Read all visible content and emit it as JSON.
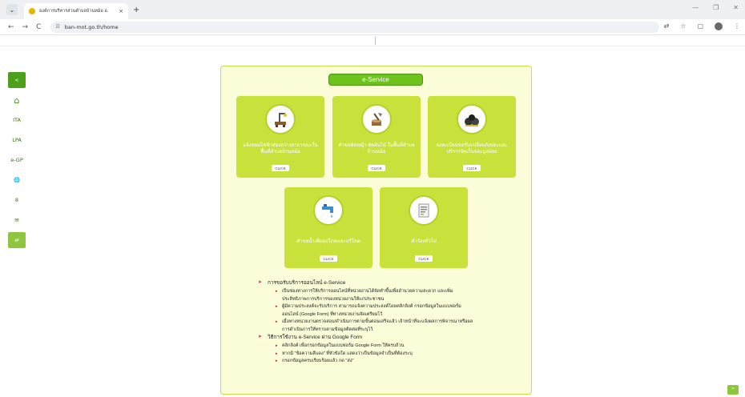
{
  "browser": {
    "tab_title": "องค์การบริหารส่วนตำบลบ้านหม้อ อ.",
    "url": "ban-mot.go.th/home",
    "new_tab": "+",
    "tab_close": "×"
  },
  "sidebar": {
    "items": [
      {
        "label": "<",
        "icon": "chevron-left-icon"
      },
      {
        "label": "⌂",
        "icon": "home-icon"
      },
      {
        "label": "ITA"
      },
      {
        "label": "LPA"
      },
      {
        "label": "e-GP"
      },
      {
        "label": "🌐",
        "icon": "globe-icon"
      },
      {
        "label": "8",
        "icon": "user-icon"
      },
      {
        "label": "✉",
        "icon": "mail-icon"
      },
      {
        "label": "⇄",
        "icon": "translate-icon"
      }
    ]
  },
  "panel": {
    "title": "e-Service",
    "services": [
      {
        "label": "แจ้งซ่อมไฟฟ้าส่องสว่างสาธารณะในพื้นที่ตำบลบ้านหม้อ",
        "click": "CLICK",
        "icon": "streetlight-icon"
      },
      {
        "label": "คำขอตัดหญ้า ตัดต้นไม้ ในพื้นที่ตำบลบ้านหม้อ",
        "click": "CLICK",
        "icon": "axe-stump-icon"
      },
      {
        "label": "ลงทะเบียนขอรับ/เปลี่ยนถังขยะและบริการจัดเก็บขยะมูลฝอย",
        "click": "CLICK",
        "icon": "garbage-bags-icon"
      },
      {
        "label": "คำขอน้ำเพื่ออุปโภคและบริโภค",
        "click": "CLICK",
        "icon": "water-tap-icon"
      },
      {
        "label": "คำร้องทั่วไป",
        "click": "CLICK",
        "icon": "document-icon"
      }
    ],
    "info": {
      "h1": "การขอรับบริการออนไลน์ e-Service",
      "b1": "เป็นช่องทางการให้บริการออนไลน์ที่หน่วยงานได้จัดทำขึ้นเพื่ออำนวยความสะดวก และเพิ่ม",
      "b1c": "ประสิทธิภาพการบริการของหน่วยงานให้แก่ประชาชน",
      "b2": "ผู้มีความประสงค์จะรับบริการ สามารถแจ้งความประสงค์โดยคลิกลิงค์ กรอกข้อมูลในแบบฟอร์ม",
      "b2c": "ออนไลน์ (Google Form) ที่ทางหน่วยงานจัดเตรียมไว้",
      "b3": "เมื่อทางหน่วยงานตรวจสอบ/ดำเนินการตามขั้นตอนเสร็จแล้ว เจ้าหน้าที่จะแจ้งผลการพิจารณาหรือผล",
      "b3c": "การดำเนินการให้ทราบตามข้อมูลติดต่อที่ระบุไว้",
      "h2": "วิธีการใช้งาน e-Service ผ่าน Google Form",
      "s1": "คลิกลิงค์ เพื่อกรอกข้อมูลในแบบฟอร์ม Google Form ให้ครบถ้วน",
      "s2": "หากมี \"ข้อความสีแดง\" ที่หัวข้อใด แสดงว่าเป็นข้อมูลจำเป็นที่ต้องระบุ",
      "s3": "กรอกข้อมูลครบเรียบร้อยแล้ว กด \"ส่ง\""
    }
  },
  "scroll_top": "^"
}
